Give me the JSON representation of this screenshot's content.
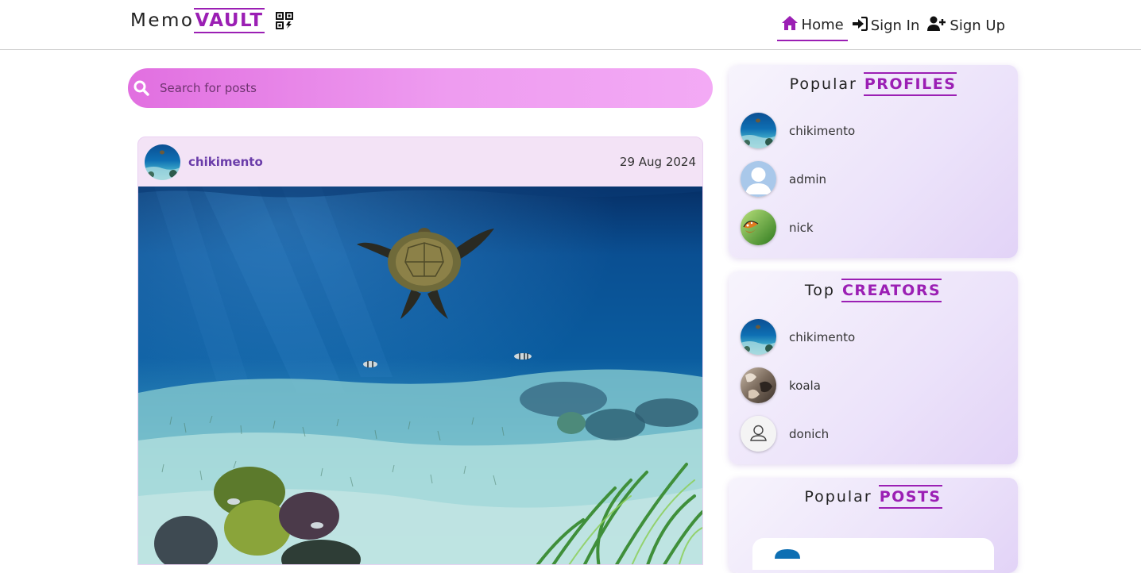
{
  "header": {
    "logo_part1": "Memo",
    "logo_part2": "VAULT",
    "logo_icon": "qr-code-icon",
    "nav": [
      {
        "label": "Home",
        "icon": "home-icon",
        "active": true
      },
      {
        "label": "Sign In",
        "icon": "sign-in-icon",
        "active": false
      },
      {
        "label": "Sign Up",
        "icon": "user-plus-icon",
        "active": false
      }
    ]
  },
  "search": {
    "placeholder": "Search for posts",
    "value": "",
    "icon": "search-icon"
  },
  "post": {
    "username": "chikimento",
    "date": "29 Aug 2024"
  },
  "popular_profiles": {
    "title_plain": "Popular",
    "title_accent": "PROFILES",
    "items": [
      {
        "name": "chikimento",
        "avatar": "underwater-avatar"
      },
      {
        "name": "admin",
        "avatar": "default-user-avatar"
      },
      {
        "name": "nick",
        "avatar": "butterfly-avatar"
      }
    ]
  },
  "top_creators": {
    "title_plain": "Top",
    "title_accent": "CREATORS",
    "items": [
      {
        "name": "chikimento",
        "avatar": "underwater-avatar"
      },
      {
        "name": "koala",
        "avatar": "koala-avatar"
      },
      {
        "name": "donich",
        "avatar": "outline-user-avatar"
      }
    ]
  },
  "popular_posts": {
    "title_plain": "Popular",
    "title_accent": "POSTS"
  },
  "colors": {
    "accent": "#9b1fb4",
    "search_gradient_start": "#e16fe0",
    "search_gradient_end": "#f3aaf5",
    "username": "#6a3ca9"
  }
}
